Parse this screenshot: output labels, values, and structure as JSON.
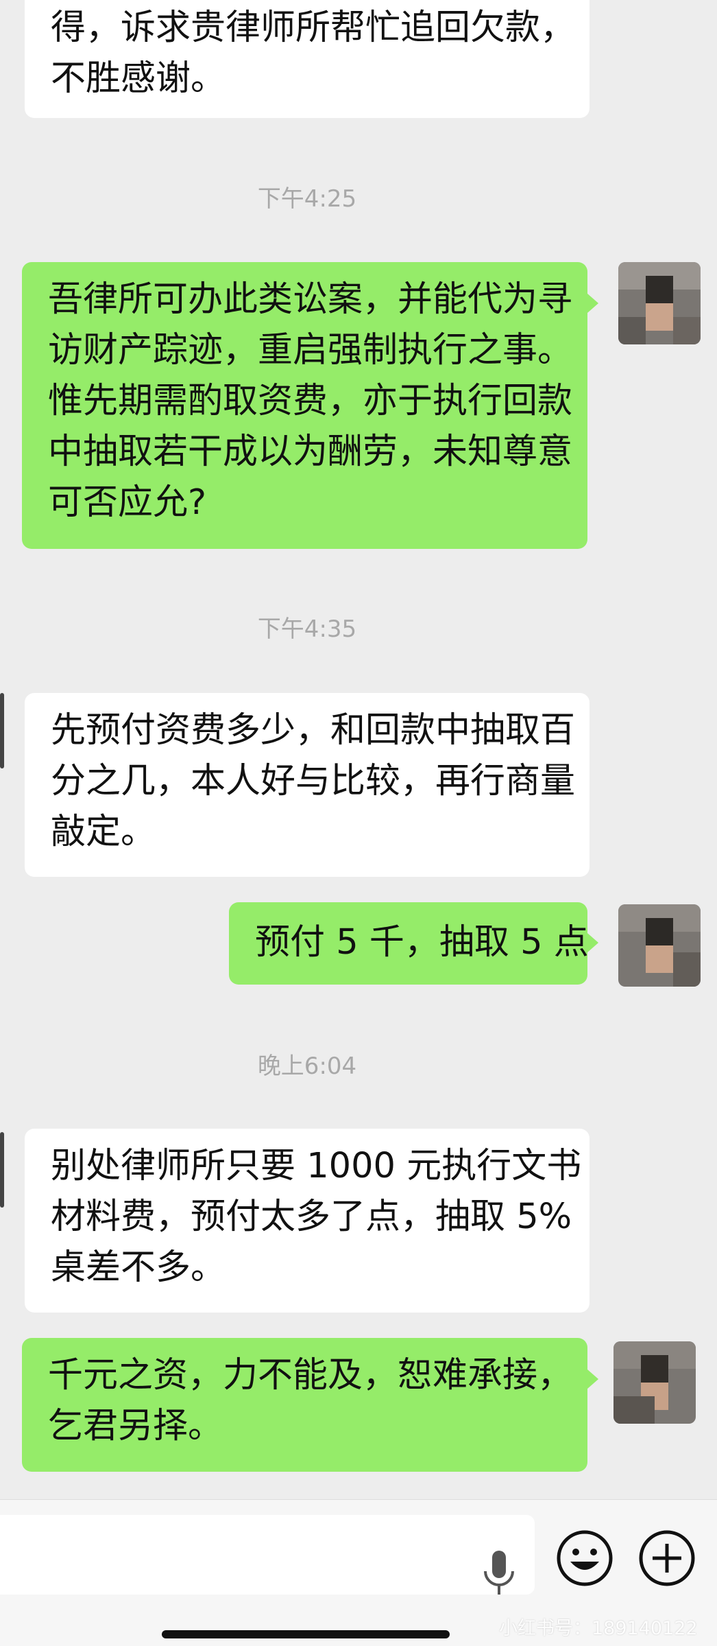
{
  "messages": [
    {
      "side": "left",
      "lines": [
        "得，诉求贵律师所帮忙追回欠款，",
        "不胜感谢。"
      ]
    },
    {
      "timestamp": "下午4:25"
    },
    {
      "side": "right",
      "lines": [
        "吾律所可办此类讼案，并能代为寻",
        "访财产踪迹，重启强制执行之事。",
        "惟先期需酌取资费，亦于执行回款",
        "中抽取若干成以为酬劳，未知尊意",
        "可否应允?"
      ]
    },
    {
      "timestamp": "下午4:35"
    },
    {
      "side": "left",
      "lines": [
        "先预付资费多少，和回款中抽取百",
        "分之几，本人好与比较，再行商量",
        "敲定。"
      ]
    },
    {
      "side": "right",
      "lines": [
        "预付 5 千，抽取 5 点"
      ]
    },
    {
      "timestamp": "晚上6:04"
    },
    {
      "side": "left",
      "lines": [
        "别处律师所只要 1000 元执行文书",
        "材料费，预付太多了点，抽取 5%",
        "桌差不多。"
      ]
    },
    {
      "side": "right",
      "lines": [
        "千元之资，力不能及，恕难承接，",
        "乞君另择。"
      ]
    }
  ],
  "timestamps": {
    "t1": "下午4:25",
    "t2": "下午4:35",
    "t3": "晚上6:04"
  },
  "bubbles": {
    "b1": {
      "l1": "得，诉求贵律师所帮忙追回欠款，",
      "l2": "不胜感谢。"
    },
    "b2": {
      "l1": "吾律所可办此类讼案，并能代为寻",
      "l2": "访财产踪迹，重启强制执行之事。",
      "l3": "惟先期需酌取资费，亦于执行回款",
      "l4": "中抽取若干成以为酬劳，未知尊意",
      "l5": "可否应允?"
    },
    "b3": {
      "l1": "先预付资费多少，和回款中抽取百",
      "l2": "分之几，本人好与比较，再行商量",
      "l3": "敲定。"
    },
    "b4": {
      "l1": "预付 5 千，抽取 5 点"
    },
    "b5": {
      "l1": "别处律师所只要 1000 元执行文书",
      "l2": "材料费，预付太多了点，抽取 5%",
      "l3": "桌差不多。"
    },
    "b6": {
      "l1": "千元之资，力不能及，恕难承接，",
      "l2": "乞君另择。"
    }
  },
  "input_bar": {
    "icons": [
      "microphone-icon",
      "emoji-icon",
      "plus-icon"
    ],
    "watermark": "小红书号：189140122"
  },
  "colors": {
    "background": "#ededed",
    "incoming_bubble": "#ffffff",
    "outgoing_bubble": "#95ec69",
    "timestamp_text": "#a8a8a8"
  }
}
